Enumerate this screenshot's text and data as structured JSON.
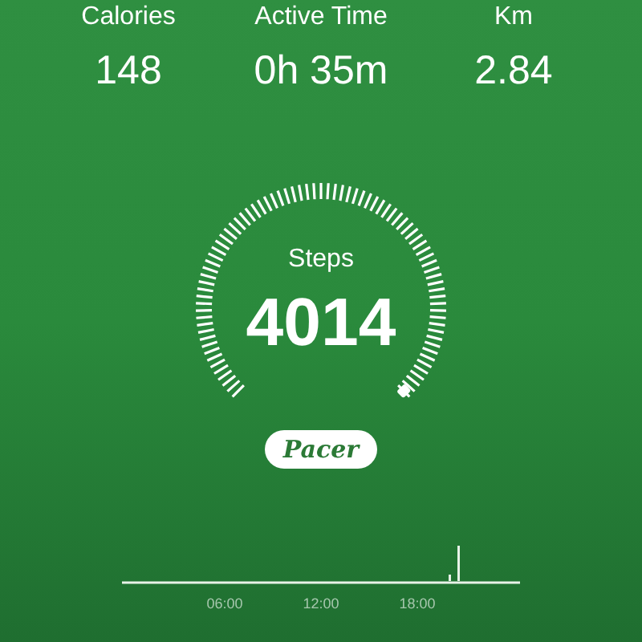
{
  "stats": [
    {
      "label": "Calories",
      "value": "148"
    },
    {
      "label": "Active Time",
      "value": "0h 35m"
    },
    {
      "label": "Km",
      "value": "2.84"
    }
  ],
  "gauge": {
    "label": "Steps",
    "value": "4014"
  },
  "brand_button": {
    "label": "Pacer"
  },
  "timeline": {
    "ticks": [
      "06:00",
      "12:00",
      "18:00"
    ]
  }
}
